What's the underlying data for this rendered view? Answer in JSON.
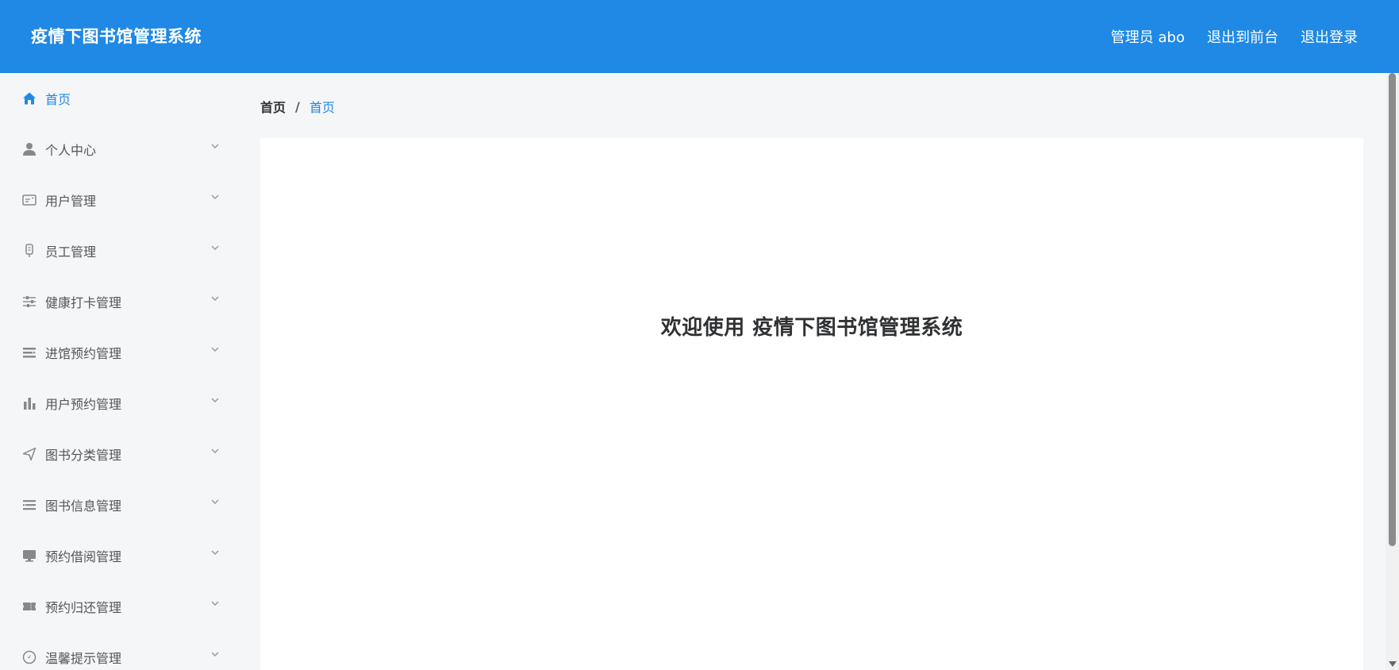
{
  "header": {
    "title": "疫情下图书馆管理系统",
    "user": "管理员 abo",
    "to_front": "退出到前台",
    "logout": "退出登录"
  },
  "sidebar": {
    "items": [
      {
        "label": "首页",
        "icon": "home-icon",
        "active": true
      },
      {
        "label": "个人中心",
        "icon": "user-icon"
      },
      {
        "label": "用户管理",
        "icon": "id-card-icon"
      },
      {
        "label": "员工管理",
        "icon": "badge-icon"
      },
      {
        "label": "健康打卡管理",
        "icon": "sliders-icon"
      },
      {
        "label": "进馆预约管理",
        "icon": "list-icon"
      },
      {
        "label": "用户预约管理",
        "icon": "bar-chart-icon"
      },
      {
        "label": "图书分类管理",
        "icon": "navigation-icon"
      },
      {
        "label": "图书信息管理",
        "icon": "menu-lines-icon"
      },
      {
        "label": "预约借阅管理",
        "icon": "monitor-icon"
      },
      {
        "label": "预约归还管理",
        "icon": "ticket-icon"
      },
      {
        "label": "温馨提示管理",
        "icon": "compass-icon"
      }
    ]
  },
  "breadcrumb": {
    "home": "首页",
    "separator": "/",
    "current": "首页"
  },
  "main": {
    "welcome": "欢迎使用 疫情下图书馆管理系统"
  },
  "colors": {
    "primary": "#1f89e5",
    "sidebar_bg": "#f5f6f8",
    "card_bg": "#ffffff"
  }
}
